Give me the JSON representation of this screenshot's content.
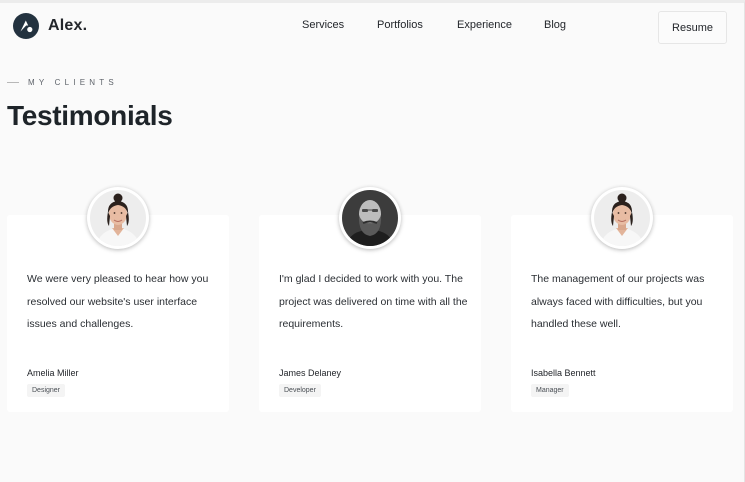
{
  "brand": {
    "name": "Alex.",
    "logo_icon": "brand-logo-icon",
    "color": "#23323f"
  },
  "nav": {
    "items": [
      {
        "label": "Services"
      },
      {
        "label": "Portfolios"
      },
      {
        "label": "Experience"
      },
      {
        "label": "Blog"
      }
    ],
    "resume_label": "Resume"
  },
  "section": {
    "eyebrow": "MY CLIENTS",
    "title": "Testimonials"
  },
  "testimonials": [
    {
      "quote": "We were very pleased to hear how you resolved our website's user interface issues and challenges.",
      "name": "Amelia Miller",
      "role": "Designer",
      "avatar_icon": "woman-portrait-icon"
    },
    {
      "quote": "I'm glad I decided to work with you. The project was delivered on time with all the requirements.",
      "name": "James Delaney",
      "role": "Developer",
      "avatar_icon": "bearded-man-portrait-icon"
    },
    {
      "quote": "The management of our projects was always faced with difficulties, but you handled these well.",
      "name": "Isabella Bennett",
      "role": "Manager",
      "avatar_icon": "woman-portrait-icon"
    }
  ]
}
